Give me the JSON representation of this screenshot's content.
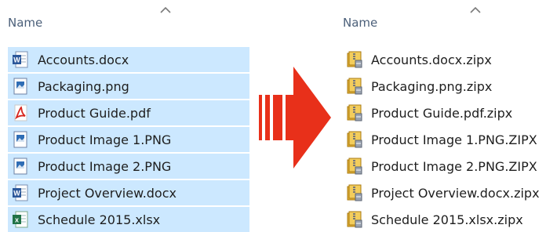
{
  "left": {
    "column_header": "Name",
    "files": [
      {
        "name": "Accounts.docx",
        "icon": "word-doc-icon"
      },
      {
        "name": "Packaging.png",
        "icon": "image-icon"
      },
      {
        "name": "Product Guide.pdf",
        "icon": "pdf-icon"
      },
      {
        "name": "Product Image 1.PNG",
        "icon": "image-icon"
      },
      {
        "name": "Product Image 2.PNG",
        "icon": "image-icon"
      },
      {
        "name": "Project Overview.docx",
        "icon": "word-doc-icon"
      },
      {
        "name": "Schedule 2015.xlsx",
        "icon": "excel-icon"
      }
    ]
  },
  "right": {
    "column_header": "Name",
    "files": [
      {
        "name": "Accounts.docx.zipx",
        "icon": "zipx-archive-icon"
      },
      {
        "name": "Packaging.png.zipx",
        "icon": "zipx-archive-icon"
      },
      {
        "name": "Product Guide.pdf.zipx",
        "icon": "zipx-archive-icon"
      },
      {
        "name": "Product Image 1.PNG.ZIPX",
        "icon": "zipx-archive-icon"
      },
      {
        "name": "Product Image 2.PNG.ZIPX",
        "icon": "zipx-archive-icon"
      },
      {
        "name": "Project Overview.docx.zipx",
        "icon": "zipx-archive-icon"
      },
      {
        "name": "Schedule 2015.xlsx.zipx",
        "icon": "zipx-archive-icon"
      }
    ]
  },
  "colors": {
    "selection": "#cce8ff",
    "arrow": "#e8301a",
    "header_text": "#4c607a"
  }
}
